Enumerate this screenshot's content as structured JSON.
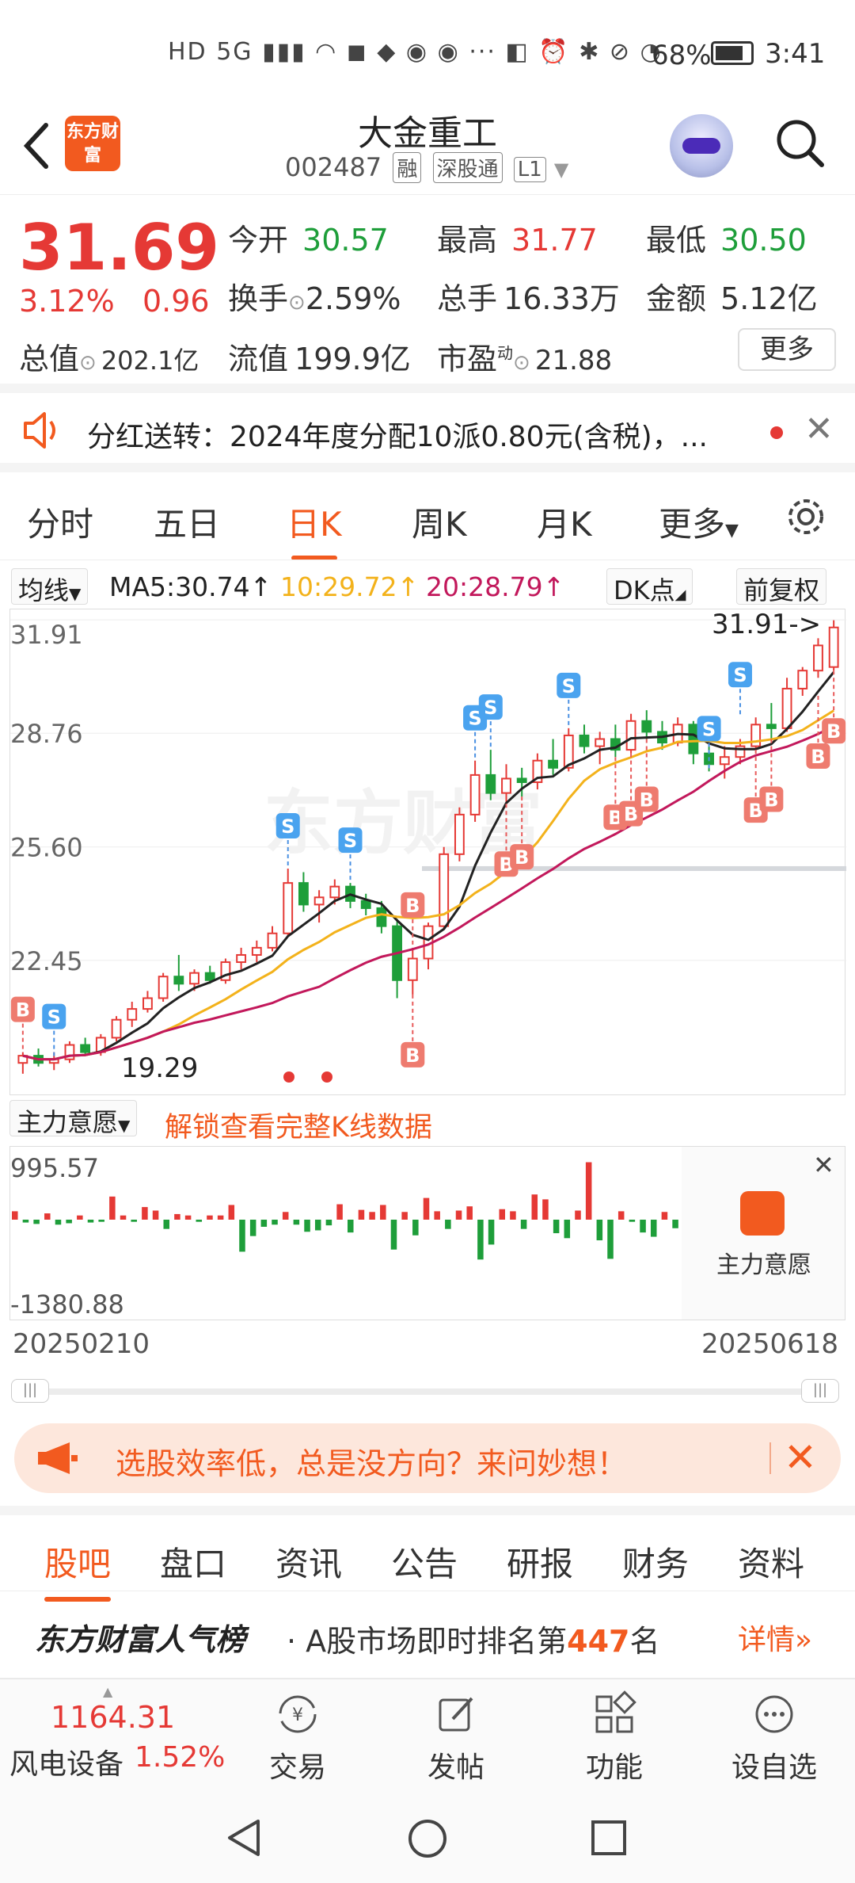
{
  "status": {
    "battery": "68%",
    "time": "3:41"
  },
  "header": {
    "logo_text": "东方财富",
    "stock_name": "大金重工",
    "stock_code": "002487",
    "tags": [
      "融",
      "深股通",
      "L1"
    ]
  },
  "quote": {
    "price": "31.69",
    "change_pct": "3.12%",
    "change": "0.96",
    "open_label": "今开",
    "open": "30.57",
    "high_label": "最高",
    "high": "31.77",
    "low_label": "最低",
    "low": "30.50",
    "turnover_label": "换手",
    "turnover": "2.59%",
    "volume_label": "总手",
    "volume": "16.33万",
    "amount_label": "金额",
    "amount": "5.12亿",
    "mcap_label": "总值",
    "mcap": "202.1亿",
    "float_label": "流值",
    "float": "199.9亿",
    "pe_label": "市盈",
    "pe_sup": "动",
    "pe": "21.88",
    "more": "更多"
  },
  "dividend": {
    "text": "分红送转：2024年度分配10派0.80元(含税)，..."
  },
  "ktabs": [
    "分时",
    "五日",
    "日K",
    "周K",
    "月K",
    "更多"
  ],
  "ma": {
    "selector": "均线",
    "ma5": "MA5:30.74↑",
    "ma10": "10:29.72↑",
    "ma20": "20:28.79↑",
    "dk": "DK点",
    "adjust": "前复权",
    "ma10_color": "#f3b21b",
    "ma20_color": "#c2185b"
  },
  "chart_data": {
    "type": "candlestick",
    "y_ticks": [
      "31.91",
      "28.76",
      "25.60",
      "22.45"
    ],
    "max_label": "31.91->",
    "min_label": "19.29",
    "watermark": "东方财富",
    "ohlc": [
      [
        19.6,
        19.9,
        19.3,
        19.8
      ],
      [
        19.8,
        20.0,
        19.5,
        19.6
      ],
      [
        19.6,
        19.9,
        19.4,
        19.7
      ],
      [
        19.7,
        20.2,
        19.6,
        20.1
      ],
      [
        20.1,
        20.3,
        19.8,
        19.9
      ],
      [
        19.9,
        20.4,
        19.8,
        20.3
      ],
      [
        20.3,
        20.9,
        20.2,
        20.8
      ],
      [
        20.8,
        21.3,
        20.6,
        21.1
      ],
      [
        21.1,
        21.6,
        21.0,
        21.4
      ],
      [
        21.4,
        22.1,
        21.3,
        22.0
      ],
      [
        22.0,
        22.6,
        21.6,
        21.8
      ],
      [
        21.8,
        22.2,
        21.6,
        22.1
      ],
      [
        22.1,
        22.3,
        21.8,
        21.9
      ],
      [
        21.9,
        22.5,
        21.8,
        22.4
      ],
      [
        22.4,
        22.8,
        22.2,
        22.6
      ],
      [
        22.6,
        23.0,
        22.4,
        22.8
      ],
      [
        22.8,
        23.4,
        22.7,
        23.2
      ],
      [
        23.2,
        25.0,
        23.1,
        24.6
      ],
      [
        24.6,
        24.9,
        23.8,
        24.0
      ],
      [
        24.0,
        24.4,
        23.5,
        24.2
      ],
      [
        24.2,
        24.7,
        24.0,
        24.5
      ],
      [
        24.5,
        24.6,
        23.9,
        24.1
      ],
      [
        24.1,
        24.3,
        23.7,
        23.9
      ],
      [
        23.9,
        24.1,
        23.2,
        23.4
      ],
      [
        23.4,
        23.6,
        21.4,
        21.9
      ],
      [
        21.9,
        22.8,
        21.5,
        22.5
      ],
      [
        22.5,
        23.5,
        22.2,
        23.4
      ],
      [
        23.4,
        25.6,
        23.3,
        25.4
      ],
      [
        25.4,
        26.7,
        25.2,
        26.5
      ],
      [
        26.5,
        28.0,
        26.3,
        27.6
      ],
      [
        27.6,
        28.3,
        26.9,
        27.1
      ],
      [
        27.1,
        27.9,
        26.8,
        27.5
      ],
      [
        27.5,
        27.8,
        27.0,
        27.4
      ],
      [
        27.4,
        28.2,
        27.2,
        28.0
      ],
      [
        28.0,
        28.6,
        27.6,
        27.8
      ],
      [
        27.8,
        28.9,
        27.7,
        28.7
      ],
      [
        28.7,
        29.0,
        28.2,
        28.4
      ],
      [
        28.4,
        28.8,
        27.9,
        28.6
      ],
      [
        28.6,
        29.0,
        28.1,
        28.3
      ],
      [
        28.3,
        29.3,
        28.2,
        29.1
      ],
      [
        29.1,
        29.4,
        28.6,
        28.8
      ],
      [
        28.8,
        29.1,
        28.3,
        28.5
      ],
      [
        28.5,
        29.2,
        28.4,
        29.0
      ],
      [
        29.0,
        29.1,
        27.9,
        28.2
      ],
      [
        28.2,
        28.5,
        27.7,
        27.9
      ],
      [
        27.9,
        28.4,
        27.5,
        28.1
      ],
      [
        28.1,
        28.6,
        27.9,
        28.4
      ],
      [
        28.4,
        29.2,
        28.3,
        29.0
      ],
      [
        29.0,
        29.6,
        28.6,
        28.9
      ],
      [
        28.9,
        30.3,
        28.8,
        30.0
      ],
      [
        30.0,
        30.6,
        29.8,
        30.5
      ],
      [
        30.5,
        31.4,
        30.3,
        31.2
      ],
      [
        30.6,
        31.9,
        30.5,
        31.7
      ]
    ],
    "signals_s": 8,
    "signals_b": 12
  },
  "indicator": {
    "selector": "主力意愿",
    "unlock": "解锁查看完整K线数据",
    "max": "995.57",
    "min": "-1380.88",
    "overlay_label": "主力意愿"
  },
  "dates": {
    "start": "20250210",
    "end": "20250618"
  },
  "ad": {
    "text": "选股效率低，总是没方向？来问妙想！"
  },
  "btabs": [
    "股吧",
    "盘口",
    "资讯",
    "公告",
    "研报",
    "财务",
    "资料"
  ],
  "rank": {
    "brand": "东方财富人气榜",
    "prefix": "· A股市场即时排名第",
    "num": "447",
    "suffix": "名",
    "detail": "详情"
  },
  "bottom": {
    "index_value": "1164.31",
    "sector": "风电设备",
    "sector_pct": "1.52%",
    "buttons": [
      "交易",
      "发帖",
      "功能",
      "设自选"
    ]
  }
}
